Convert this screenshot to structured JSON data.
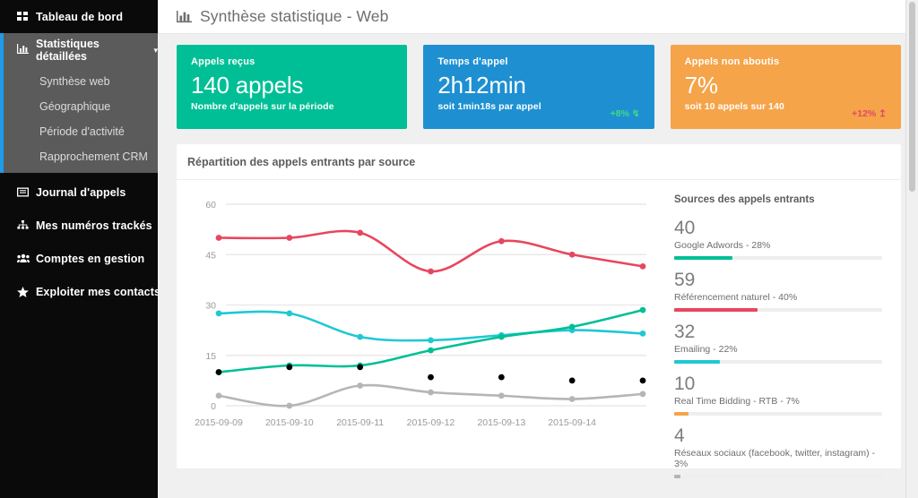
{
  "sidebar": {
    "items": [
      {
        "label": "Tableau de bord",
        "icon": "grid-icon",
        "type": "link"
      },
      {
        "label": "Statistiques détaillées",
        "icon": "bar-chart-icon",
        "type": "group",
        "expanded": true,
        "children": [
          {
            "label": "Synthèse web"
          },
          {
            "label": "Géographique"
          },
          {
            "label": "Période d'activité"
          },
          {
            "label": "Rapprochement CRM"
          }
        ]
      },
      {
        "label": "Journal d'appels",
        "icon": "list-icon",
        "type": "link"
      },
      {
        "label": "Mes numéros trackés",
        "icon": "sitemap-icon",
        "type": "link"
      },
      {
        "label": "Comptes en gestion",
        "icon": "users-icon",
        "type": "link"
      },
      {
        "label": "Exploiter mes contacts",
        "icon": "star-icon",
        "type": "link"
      }
    ],
    "accent_color": "#1e9be9",
    "active_bg": "#5b5b5b",
    "bg": "#0a0a0a"
  },
  "header": {
    "title": "Synthèse statistique - Web",
    "icon": "bar-chart-icon"
  },
  "kpis": [
    {
      "title": "Appels reçus",
      "value": "140 appels",
      "sub": "Nombre d'appels sur la période",
      "delta": "",
      "delta_icon": "",
      "color": "#00bf96",
      "delta_color": ""
    },
    {
      "title": "Temps d'appel",
      "value": "2h12min",
      "sub": "soit 1min18s par appel",
      "delta": "+8%",
      "delta_icon": "↯",
      "color": "#1e90d2",
      "delta_color": "#3ddc84"
    },
    {
      "title": "Appels non aboutis",
      "value": "7%",
      "sub": "soit 10 appels sur 140",
      "delta": "+12%",
      "delta_icon": "↥",
      "color": "#f5a council",
      "delta_color": "#e04a63"
    }
  ],
  "panel": {
    "title": "Répartition des appels entrants par source"
  },
  "sources": {
    "heading": "Sources des appels entrants",
    "items": [
      {
        "count": "40",
        "label": "Google Adwords - 28%",
        "pct": 28,
        "color": "#00bf96"
      },
      {
        "count": "59",
        "label": "Référencement naturel - 40%",
        "pct": 40,
        "color": "#e8465e"
      },
      {
        "count": "32",
        "label": "Emailing - 22%",
        "pct": 22,
        "color": "#1fc8d4"
      },
      {
        "count": "10",
        "label": "Real Time Bidding - RTB - 7%",
        "pct": 7,
        "color": "#f5a councilb33"
      },
      {
        "count": "4",
        "label": "Réseaux sociaux (facebook, twitter, instagram) - 3%",
        "pct": 3,
        "color": "#b5b5b5"
      }
    ]
  },
  "chart_data": {
    "type": "line",
    "title": "Répartition des appels entrants par source",
    "xlabel": "",
    "ylabel": "",
    "ylim": [
      0,
      60
    ],
    "yticks": [
      0,
      15,
      30,
      45,
      60
    ],
    "grid": true,
    "legend": "none",
    "x": [
      "2015-09-09",
      "2015-09-10",
      "2015-09-11",
      "2015-09-12",
      "2015-09-13",
      "2015-09-14",
      ""
    ],
    "categories": [
      "2015-09-09",
      "2015-09-10",
      "2015-09-11",
      "2015-09-12",
      "2015-09-13",
      "2015-09-14",
      ""
    ],
    "series": [
      {
        "name": "Référencement naturel",
        "color": "#e8465e",
        "values": [
          50,
          50,
          51.5,
          40,
          49,
          45,
          41.5
        ]
      },
      {
        "name": "Emailing",
        "color": "#1fc8d4",
        "values": [
          27.5,
          27.5,
          20.5,
          19.5,
          21,
          22.5,
          21.5
        ]
      },
      {
        "name": "Google Adwords",
        "color": "#00bf96",
        "values": [
          10,
          12,
          12,
          16.5,
          20.5,
          23.5,
          28.5
        ]
      },
      {
        "name": "Real Time Bidding - RTB",
        "color": "#f5a councilb33",
        "values": [
          10,
          11.5,
          11.5,
          8.5,
          8.5,
          7.5,
          7.5
        ]
      },
      {
        "name": "Réseaux sociaux",
        "color": "#b5b5b5",
        "values": [
          3,
          0,
          6,
          4,
          3,
          2,
          3.5
        ]
      }
    ]
  }
}
